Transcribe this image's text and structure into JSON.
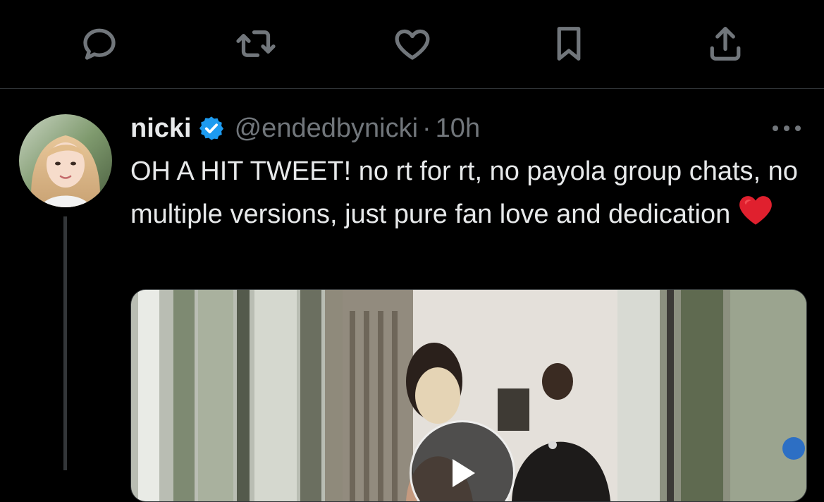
{
  "action_bar": {
    "icons": [
      "reply-icon",
      "retweet-icon",
      "like-icon",
      "bookmark-icon",
      "share-icon"
    ],
    "icon_color": "#71767b"
  },
  "tweet": {
    "author_name": "nicki",
    "verified": true,
    "verified_color": "#1d9bf0",
    "handle": "@endedbynicki",
    "separator": "·",
    "time": "10h",
    "text": "OH A HIT TWEET! no rt for rt, no payola group chats, no multiple versions, just pure fan love and dedication",
    "emoji": "red-heart-emoji",
    "media_type": "video"
  },
  "colors": {
    "background": "#000000",
    "text_primary": "#e7e9ea",
    "text_secondary": "#71767b",
    "divider": "#2f3336"
  }
}
